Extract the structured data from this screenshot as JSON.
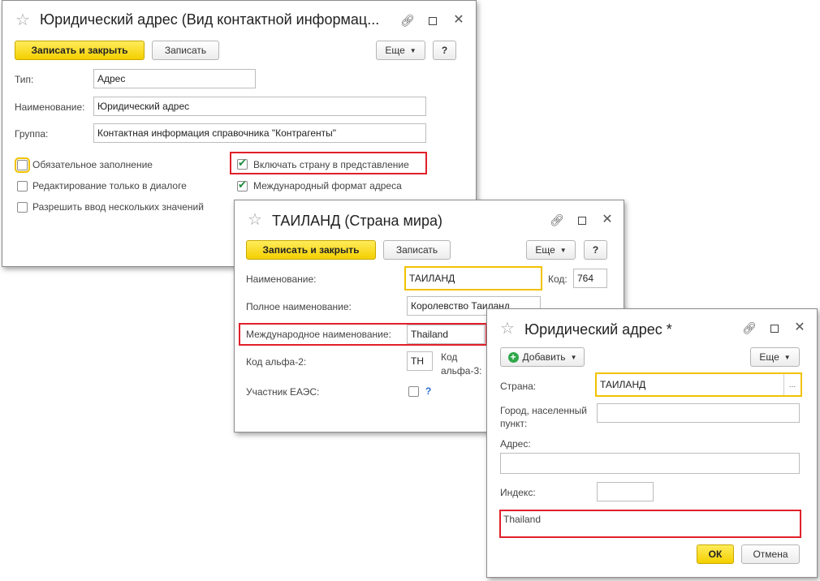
{
  "win1": {
    "title": "Юридический адрес (Вид контактной информац...",
    "save_close": "Записать и закрыть",
    "save": "Записать",
    "more": "Еще",
    "help": "?",
    "type_label": "Тип:",
    "type_value": "Адрес",
    "name_label": "Наименование:",
    "name_value": "Юридический адрес",
    "group_label": "Группа:",
    "group_value": "Контактная информация справочника \"Контрагенты\"",
    "cb_required": "Обязательное заполнение",
    "cb_dialog_only": "Редактирование только в диалоге",
    "cb_multi": "Разрешить ввод нескольких значений",
    "cb_include_country": "Включать страну в представление",
    "cb_intl_format": "Международный формат адреса"
  },
  "win2": {
    "title": "ТАИЛАНД (Страна мира)",
    "save_close": "Записать и закрыть",
    "save": "Записать",
    "more": "Еще",
    "help": "?",
    "name_label": "Наименование:",
    "name_value": "ТАИЛАНД",
    "code_label": "Код:",
    "code_value": "764",
    "full_name_label": "Полное наименование:",
    "full_name_value": "Королевство Таиланд",
    "intl_name_label": "Международное наименование:",
    "intl_name_value": "Thailand",
    "alpha2_label": "Код альфа-2:",
    "alpha2_value": "TH",
    "alpha3_label_1": "Код",
    "alpha3_label_2": "альфа-3:",
    "eaeu_label": "Участник ЕАЭС:",
    "eaeu_help": "?"
  },
  "win3": {
    "title": "Юридический адрес *",
    "add": "Добавить",
    "more": "Еще",
    "country_label": "Страна:",
    "country_value": "ТАИЛАНД",
    "country_select": "...",
    "city_label_1": "Город, населенный",
    "city_label_2": "пункт:",
    "address_label": "Адрес:",
    "index_label": "Индекс:",
    "presentation": "Thailand",
    "ok": "ОК",
    "cancel": "Отмена"
  }
}
